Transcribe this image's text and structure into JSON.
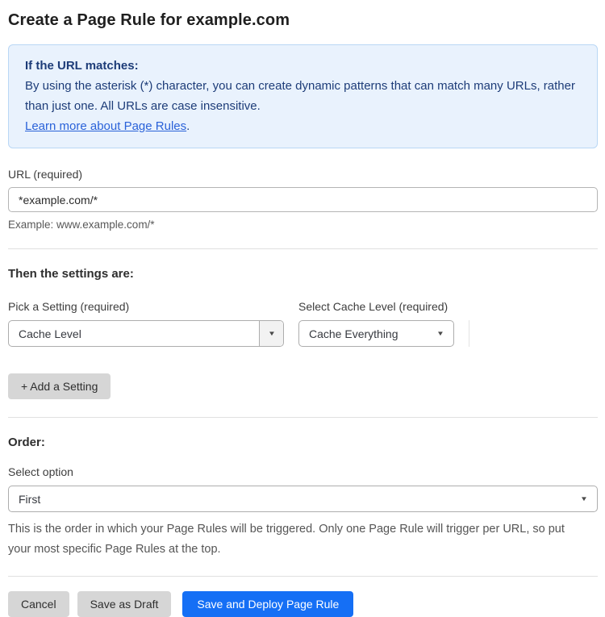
{
  "page": {
    "title": "Create a Page Rule for example.com"
  },
  "info_box": {
    "heading": "If the URL matches:",
    "body": "By using the asterisk (*) character, you can create dynamic patterns that can match many URLs, rather than just one. All URLs are case insensitive.",
    "link_label": "Learn more about Page Rules",
    "link_suffix": "."
  },
  "url_field": {
    "label": "URL (required)",
    "value": "*example.com/*",
    "example": "Example: www.example.com/*"
  },
  "settings": {
    "heading": "Then the settings are:",
    "pick_setting": {
      "label": "Pick a Setting (required)",
      "value": "Cache Level"
    },
    "cache_level": {
      "label": "Select Cache Level (required)",
      "value": "Cache Everything"
    },
    "add_button_label": "+ Add a Setting"
  },
  "order": {
    "heading": "Order:",
    "select_label": "Select option",
    "value": "First",
    "help": "This is the order in which your Page Rules will be triggered. Only one Page Rule will trigger per URL, so put your most specific Page Rules at the top."
  },
  "footer": {
    "cancel_label": "Cancel",
    "save_draft_label": "Save as Draft",
    "save_deploy_label": "Save and Deploy Page Rule"
  },
  "icons": {
    "dropdown_arrow": "▼"
  },
  "colors": {
    "info_box_bg": "#e9f2fd",
    "info_box_border": "#b9d7f5",
    "info_text": "#1d3c78",
    "link_blue": "#2a62d9",
    "primary_button_blue": "#156ff5",
    "gray_button": "#d6d6d6"
  }
}
